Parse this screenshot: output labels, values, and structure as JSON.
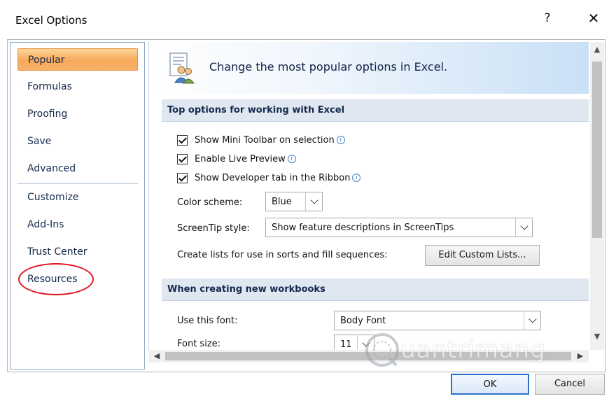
{
  "window": {
    "title": "Excel Options",
    "help_label": "?",
    "close_label": "✕"
  },
  "nav": {
    "items": [
      {
        "label": "Popular",
        "active": true
      },
      {
        "label": "Formulas"
      },
      {
        "label": "Proofing"
      },
      {
        "label": "Save"
      },
      {
        "label": "Advanced"
      },
      {
        "label": "Customize"
      },
      {
        "label": "Add-Ins"
      },
      {
        "label": "Trust Center"
      },
      {
        "label": "Resources"
      }
    ]
  },
  "header": {
    "text": "Change the most popular options in Excel."
  },
  "sections": {
    "top": {
      "title": "Top options for working with Excel",
      "checkboxes": [
        {
          "label": "Show Mini Toolbar on selection",
          "checked": true
        },
        {
          "label": "Enable Live Preview",
          "checked": true
        },
        {
          "label": "Show Developer tab in the Ribbon",
          "checked": true
        }
      ],
      "color_scheme_label": "Color scheme:",
      "color_scheme_value": "Blue",
      "screentip_label": "ScreenTip style:",
      "screentip_value": "Show feature descriptions in ScreenTips",
      "lists_label": "Create lists for use in sorts and fill sequences:",
      "edit_lists_button": "Edit Custom Lists..."
    },
    "new_workbooks": {
      "title": "When creating new workbooks",
      "font_label": "Use this font:",
      "font_value": "Body Font",
      "size_label": "Font size:",
      "size_value": "11"
    }
  },
  "footer": {
    "ok_label": "OK",
    "cancel_label": "Cancel"
  },
  "watermark": {
    "text": "uantrimang"
  },
  "colors": {
    "accent": "#2a72c9",
    "active_nav": "#f7a95a",
    "annotation": "#e0141d"
  }
}
